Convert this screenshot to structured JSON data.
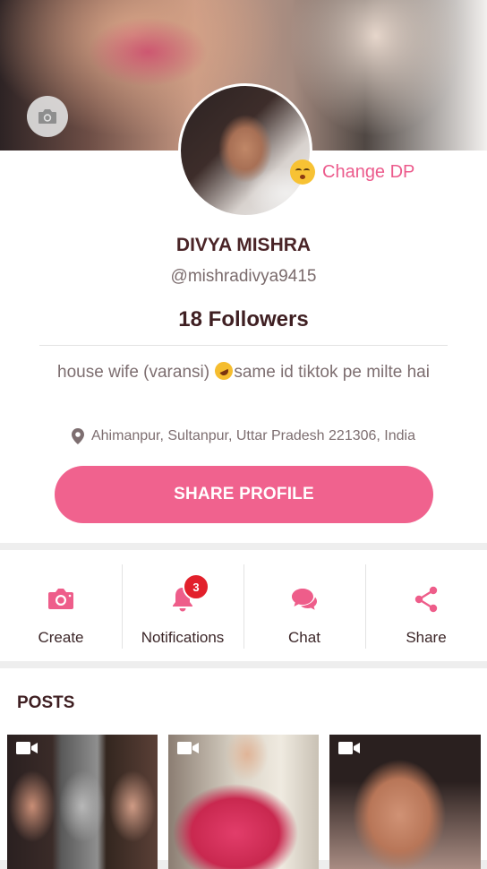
{
  "profile": {
    "change_dp_label": "Change DP",
    "name": "DIVYA MISHRA",
    "handle": "@mishradivya9415",
    "followers": "18 Followers",
    "bio_part1": "house wife (varansi) ",
    "bio_part2": "same id tiktok pe milte hai",
    "location": "Ahimanpur, Sultanpur, Uttar Pradesh 221306, India",
    "share_profile_label": "SHARE PROFILE"
  },
  "actions": [
    {
      "label": "Create",
      "icon": "camera-icon"
    },
    {
      "label": "Notifications",
      "icon": "bell-icon",
      "badge": "3"
    },
    {
      "label": "Chat",
      "icon": "chat-icon"
    },
    {
      "label": "Share",
      "icon": "share-icon"
    }
  ],
  "posts": {
    "title": "POSTS",
    "items": [
      {
        "type": "video",
        "icon": "video-camera-icon"
      },
      {
        "type": "video",
        "icon": "video-camera-icon"
      },
      {
        "type": "video",
        "icon": "video-camera-icon"
      }
    ]
  },
  "colors": {
    "accent": "#f0628e",
    "accent_text": "#ec5b8c",
    "badge": "#e2202b",
    "name_text": "#4a2427"
  }
}
